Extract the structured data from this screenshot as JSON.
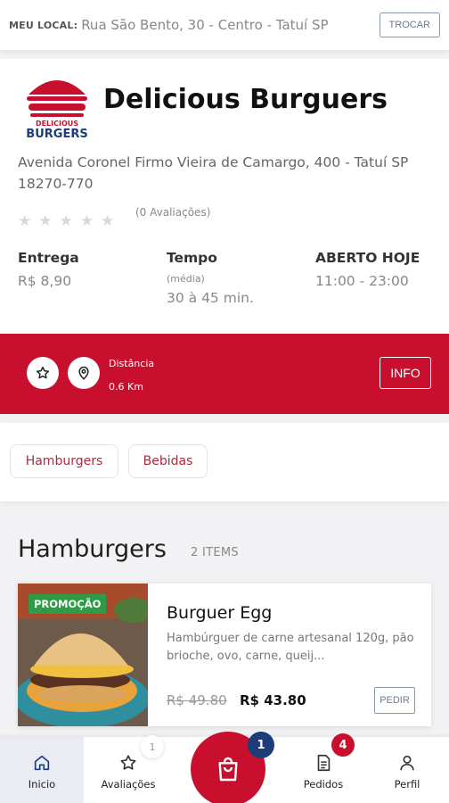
{
  "location": {
    "label": "MEU LOCAL:",
    "address": "Rua São Bento, 30 - Centro - Tatuí SP",
    "change_button": "TROCAR"
  },
  "restaurant": {
    "logo_text_top": "DELICIOUS",
    "logo_text_bottom": "BURGERS",
    "name": "Delicious Burguers",
    "address": "Avenida Coronel Firmo Vieira de Camargo, 400 - Tatuí SP 18270-770",
    "rating": 0,
    "reviews": "(0 Avaliações)",
    "delivery": {
      "label": "Entrega",
      "value": "R$ 8,90"
    },
    "time": {
      "label": "Tempo",
      "note": "(média)",
      "value": "30 à 45 min."
    },
    "open": {
      "label": "ABERTO HOJE",
      "value": "11:00 - 23:00"
    }
  },
  "info_bar": {
    "distance_label": "Distância",
    "distance_value": "0.6 Km",
    "info_button": "INFO",
    "icons": [
      "star-icon",
      "location-pin-icon"
    ]
  },
  "categories": [
    "Hamburgers",
    "Bebidas"
  ],
  "section": {
    "title": "Hamburgers",
    "count": "2 ITEMS"
  },
  "product": {
    "badge": "PROMOÇÃO",
    "name": "Burguer Egg",
    "description": "Hambúrguer de carne artesanal 120g, pão brioche, ovo, carne, queij...",
    "old_price": "R$ 49.80",
    "price": "R$ 43.80",
    "order_button": "PEDIR"
  },
  "bottom_nav": {
    "home": "Inicio",
    "reviews": "Avaliações",
    "reviews_badge": "1",
    "cart_badge": "1",
    "orders": "Pedidos",
    "orders_badge": "4",
    "profile": "Perfil"
  },
  "colors": {
    "brand_red": "#c8102e",
    "promo_green": "#2e9b47",
    "cart_badge": "#1c3c7a",
    "text_muted": "#888888"
  }
}
